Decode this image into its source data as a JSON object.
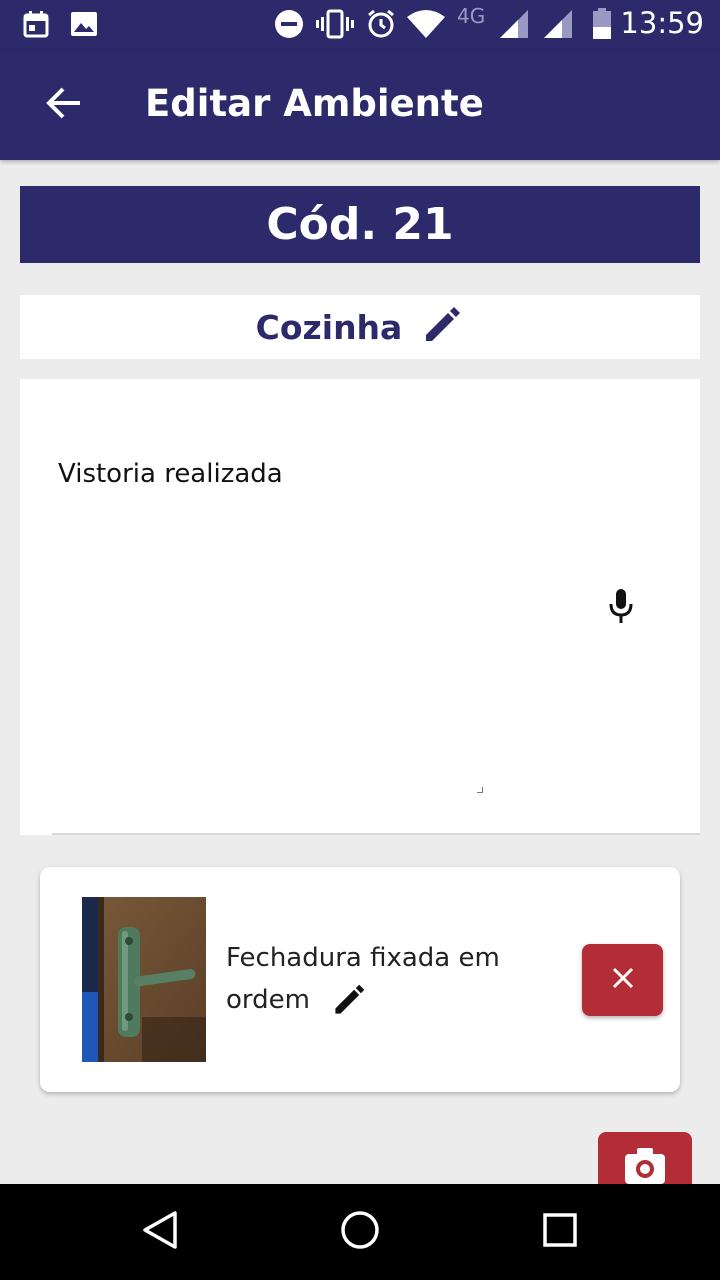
{
  "status_bar": {
    "time": "13:59",
    "network": "4G",
    "icons": [
      "calendar-icon",
      "image-icon",
      "do-not-disturb-icon",
      "vibrate-icon",
      "alarm-icon",
      "wifi-icon",
      "signal-icon",
      "signal-icon",
      "battery-icon"
    ]
  },
  "app_bar": {
    "title": "Editar Ambiente",
    "back_icon": "arrow-back-icon"
  },
  "code_banner": {
    "text": "Cód. 21"
  },
  "room": {
    "name": "Cozinha",
    "edit_icon": "pencil-icon"
  },
  "notes": {
    "value": "Vistoria realizada",
    "mic_icon": "microphone-icon"
  },
  "photo_item": {
    "caption": "Fechadura fixada em ordem",
    "edit_icon": "pencil-icon",
    "delete_icon": "close-icon"
  },
  "camera_button": {
    "icon": "camera-icon"
  },
  "nav_bar": {
    "buttons": [
      "back-triangle-icon",
      "home-circle-icon",
      "recents-square-icon"
    ]
  },
  "colors": {
    "primary": "#2c2a6b",
    "danger": "#b22d36",
    "background": "#ececec"
  }
}
